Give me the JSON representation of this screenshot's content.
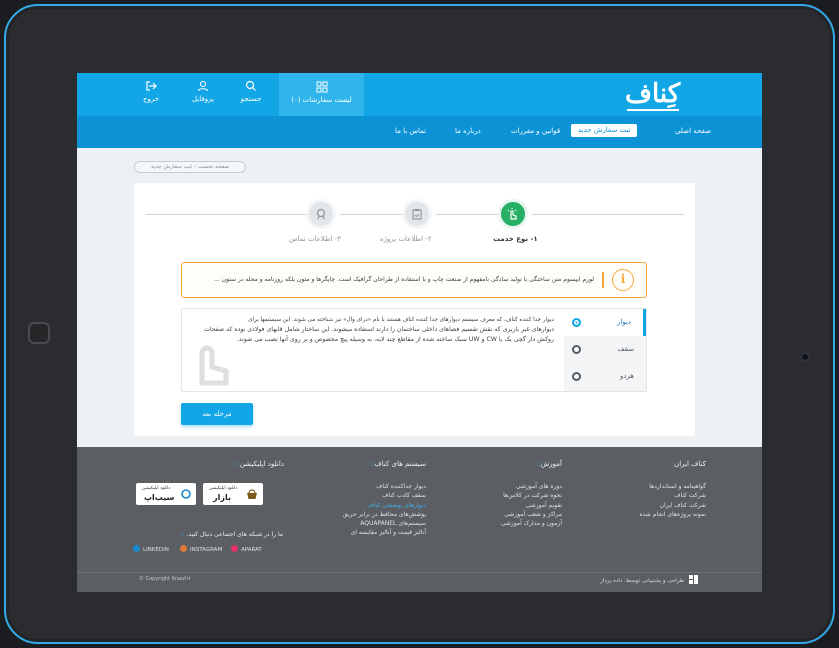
{
  "topbar": {
    "logout": "خروج",
    "profile": "پروفایل",
    "search": "جستجو",
    "basket": "لیست سفارشات (۰)",
    "logo": "کِناف"
  },
  "nav": {
    "home": "صفحه اصلی",
    "new_order": "ثبت سفارش جدید",
    "rules": "قوانین و مقررات",
    "about": "درباره ما",
    "contact": "تماس با ما"
  },
  "breadcrumb": "صفحه نخست  ›  ثبت سفارش جدید",
  "steps": [
    {
      "label": "۱- نوع خدمت",
      "active": true
    },
    {
      "label": "۲- اطلاعات پروژه",
      "active": false
    },
    {
      "label": "۳- اطلاعات تماس",
      "active": false
    }
  ],
  "notice": {
    "icon": "i",
    "text": "لورم ایپسوم متن ساختگی با تولید سادگی نامفهوم از صنعت چاپ و با استفاده از طراحان گرافیک است. چاپگرها و متون بلکه روزنامه و مجله در ستون ..."
  },
  "options": [
    {
      "label": "دیوار",
      "selected": true
    },
    {
      "label": "سقف",
      "selected": false
    },
    {
      "label": "هردو",
      "selected": false
    }
  ],
  "description": {
    "line1": "دیوار جدا کننده کناف، که معرف سیستم دیوارهای جدا کننده کناف هستند با نام «درای وال» نیز شناخته می شوند. این سیستمها برای",
    "line2": "دیوارهای غیر باربری که نقش تقسیم فضاهای داخلی ساختمان را دارند استفاده میشوند. این ساختار شامل قابهای فولادی بوده که صفحات",
    "line3": "روکش دار گچی یک یا CW و UW سبک ساخته شده از مقاطع چند لایه، به وسیله پیچ مخصوص و بر روی آنها نصب می شوند."
  },
  "next_button": "مرحله بعد",
  "footer": {
    "col_knauf": {
      "title": "کناف ایران",
      "links": [
        "گواهینامه و استانداردها",
        "شرکت کناف",
        "شرکت کناف ایران",
        "نمونه پروژه‌های انجام شده"
      ]
    },
    "col_training": {
      "title": "آموزش",
      "links": [
        "دوره های آموزشی",
        "نحوه شرکت در کلاس‌ها",
        "تقویم آموزشی",
        "مراکز و شعب آموزشی",
        "آزمون و مدارک آموزشی"
      ]
    },
    "col_systems": {
      "title": "سیستم های کناف",
      "links": [
        "دیوار جداکننده کناف",
        "سقف کاذب کناف",
        "دیوارهای پوششی کناف",
        "پوشش‌های محافظ در برابر حریق",
        "سیستم‌های AQUAPANEL",
        "آنالیز قیمت و آنالیز مقایسه ای"
      ],
      "highlight_index": 2
    },
    "col_app": {
      "title": "دانلود اپلیکیشن",
      "badge_small": "دانلود اپلیکیشن",
      "badge1": "بازار",
      "badge2": "سیب‌اپ"
    },
    "social_title": "ما را در شبکه های اجتماعی دنبال کنید.",
    "social": [
      "APARAT",
      "INSTAGRAM",
      "LINKEDIN"
    ],
    "copyright": "© Copyright Knauf.ir",
    "credit": "طراحی و پشتیبانی توسط: داده پرداز"
  },
  "colors": {
    "primary": "#12a6e6",
    "nav": "#0c93d6",
    "success": "#27b065",
    "warning": "#f2a83a",
    "footer": "#5b5e62",
    "bezel_accent": "#33a9e6"
  }
}
